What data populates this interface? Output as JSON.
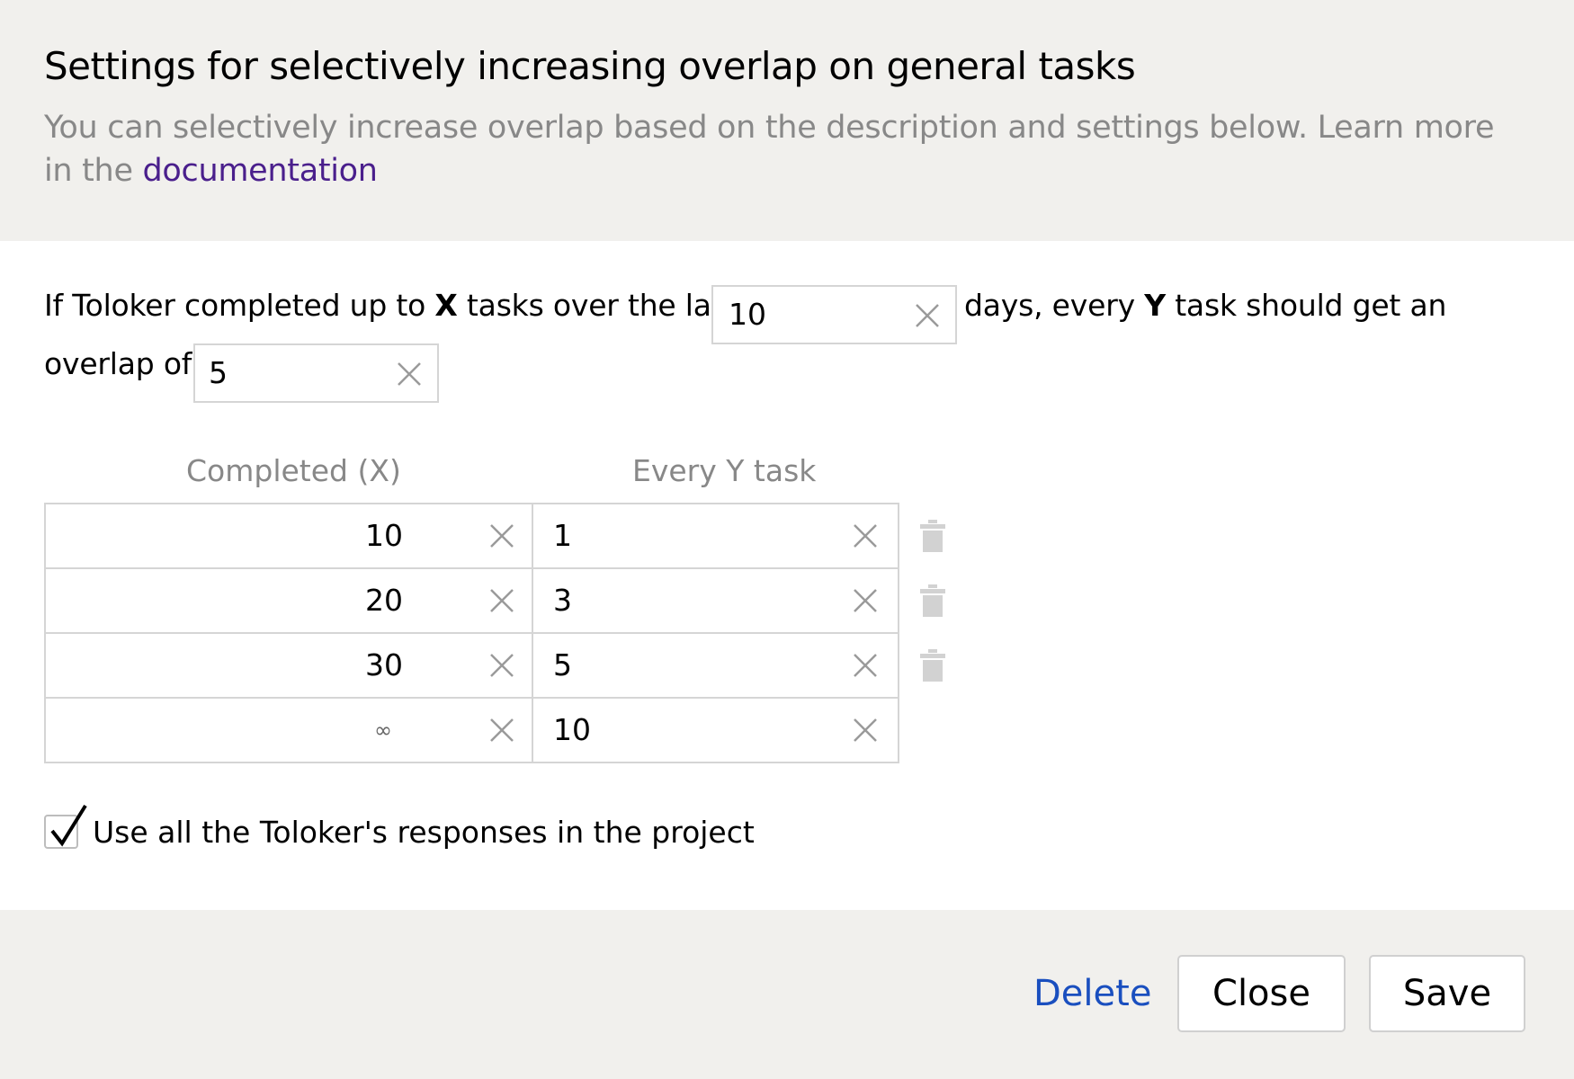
{
  "dialog": {
    "title": "Settings for selectively increasing overlap on general tasks",
    "subtitle_text": "You can selectively increase overlap based on the description and settings below. Learn more in the ",
    "subtitle_link": "documentation"
  },
  "rule": {
    "part1": "If Toloker completed up to ",
    "x": "X",
    "part2": " tasks over the last",
    "days_value": "10",
    "part3": "days, every ",
    "y": "Y",
    "part4": " task should get an",
    "part5": "overlap of",
    "overlap_value": "5"
  },
  "table": {
    "headers": {
      "completed": "Completed (X)",
      "every_y": "Every Y task"
    },
    "rows": [
      {
        "completed": "10",
        "every_y": "1",
        "deletable": true
      },
      {
        "completed": "20",
        "every_y": "3",
        "deletable": true
      },
      {
        "completed": "30",
        "every_y": "5",
        "deletable": true
      },
      {
        "completed": "∞",
        "every_y": "10",
        "deletable": false
      }
    ]
  },
  "options": {
    "use_all_responses_label": "Use all the Toloker's responses in the project",
    "use_all_responses_checked": true
  },
  "footer": {
    "delete_label": "Delete",
    "close_label": "Close",
    "save_label": "Save"
  },
  "colors": {
    "header_bg": "#f1f0ed",
    "link_purple": "#4a1f8c",
    "link_blue": "#1a4fbf",
    "muted_text": "#888888",
    "border": "#d5d5d5"
  }
}
